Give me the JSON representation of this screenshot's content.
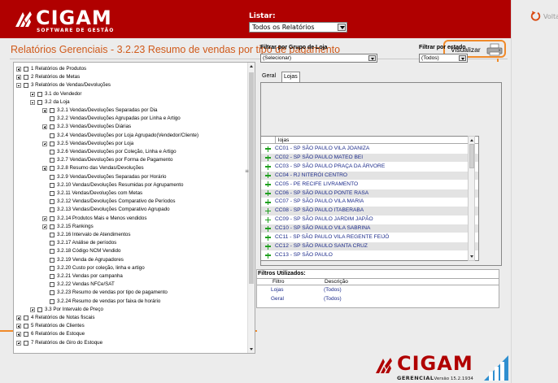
{
  "header": {
    "brand": "CIGAM",
    "brand_sub": "SOFTWARE DE GESTÃO",
    "list_label": "Listar:",
    "list_selected": "Todos os Relatórios"
  },
  "nav": {
    "back_label": "Voltar"
  },
  "page": {
    "title": "Relatórios Gerenciais - 3.2.23 Resumo de vendas por tipo de pagamento",
    "visualize_label": "Visualizar"
  },
  "tree": [
    {
      "label": "1 Relatórios de Produtos",
      "level": 0,
      "expander": "plus"
    },
    {
      "label": "2 Relatórios de Metas",
      "level": 0,
      "expander": "plus"
    },
    {
      "label": "3 Relatórios de Vendas/Devoluções",
      "level": 0,
      "expander": "minus"
    },
    {
      "label": "3.1 do Vendedor",
      "level": 1,
      "expander": "plus"
    },
    {
      "label": "3.2 da Loja",
      "level": 1,
      "expander": "minus"
    },
    {
      "label": "3.2.1 Vendas/Devoluções Separadas por Dia",
      "level": 2,
      "expander": "plus"
    },
    {
      "label": "3.2.2 Vendas/Devoluções Agrupadas por Linha e Artigo",
      "level": 2,
      "expander": "none"
    },
    {
      "label": "3.2.3 Vendas/Devoluções Diárias",
      "level": 2,
      "expander": "plus"
    },
    {
      "label": "3.2.4 Vendas/Devoluções por Loja Agrupado(Vendedor/Cliente)",
      "level": 2,
      "expander": "none"
    },
    {
      "label": "3.2.5 Vendas/Devoluções por Loja",
      "level": 2,
      "expander": "plus"
    },
    {
      "label": "3.2.6 Vendas/Devoluções por Coleção, Linha e Artigo",
      "level": 2,
      "expander": "none"
    },
    {
      "label": "3.2.7 Vendas/Devoluções por Forma de Pagamento",
      "level": 2,
      "expander": "none"
    },
    {
      "label": "3.2.8 Resumo das Vendas/Devoluções",
      "level": 2,
      "expander": "plus"
    },
    {
      "label": "3.2.9 Vendas/Devoluções Separadas por Horário",
      "level": 2,
      "expander": "none"
    },
    {
      "label": "3.2.10 Vendas/Devoluções Resumidas por Agrupamento",
      "level": 2,
      "expander": "none"
    },
    {
      "label": "3.2.11 Vendas/Devoluções com Metas",
      "level": 2,
      "expander": "none"
    },
    {
      "label": "3.2.12 Vendas/Devoluções Comparativo de Períodos",
      "level": 2,
      "expander": "none"
    },
    {
      "label": "3.2.13 Vendas/Devoluções Comparativo Agrupado",
      "level": 2,
      "expander": "none"
    },
    {
      "label": "3.2.14 Produtos Mais e Menos vendidos",
      "level": 2,
      "expander": "plus"
    },
    {
      "label": "3.2.15 Rankings",
      "level": 2,
      "expander": "plus"
    },
    {
      "label": "3.2.16 Intervalo de Atendimentos",
      "level": 2,
      "expander": "none"
    },
    {
      "label": "3.2.17 Análise de períodos",
      "level": 2,
      "expander": "none"
    },
    {
      "label": "3.2.18 Código NCM Vendido",
      "level": 2,
      "expander": "none"
    },
    {
      "label": "3.2.19 Venda de Agrupadores",
      "level": 2,
      "expander": "none"
    },
    {
      "label": "3.2.20 Custo por coleção, linha e artigo",
      "level": 2,
      "expander": "none"
    },
    {
      "label": "3.2.21 Vendas por campanha",
      "level": 2,
      "expander": "none"
    },
    {
      "label": "3.2.22 Vendas NFCe/SAT",
      "level": 2,
      "expander": "none"
    },
    {
      "label": "3.2.23 Resumo de vendas por tipo de pagamento",
      "level": 2,
      "expander": "none"
    },
    {
      "label": "3.2.24 Resumo de vendas por faixa de horário",
      "level": 2,
      "expander": "none"
    },
    {
      "label": "3.3 Por Intervalo de Preço",
      "level": 1,
      "expander": "plus"
    },
    {
      "label": "4 Relatórios de Notas fiscais",
      "level": 0,
      "expander": "plus"
    },
    {
      "label": "5 Relatórios de Clientes",
      "level": 0,
      "expander": "plus"
    },
    {
      "label": "6 Relatórios de Estoque",
      "level": 0,
      "expander": "plus"
    },
    {
      "label": "7 Relatórios de Giro do Estoque",
      "level": 0,
      "expander": "plus"
    }
  ],
  "tabs": [
    "Geral",
    "Lojas"
  ],
  "filters": {
    "group_label": "Filtrar por Grupo de Loja",
    "group_value": "(Selecionar)",
    "state_label": "Filtrar por estado",
    "state_value": "(Todos)"
  },
  "stores": {
    "header": "lojas",
    "rows": [
      "CC01 - SP SÃO PAULO VILA JOANIZA",
      "CC02 - SP SÃO PAULO MATEO BEI",
      "CC03 - SP SÃO PAULO PRAÇA DA ÁRVORE",
      "CC04 - RJ  NITERÓI CENTRO",
      "CC05 - PE RECIFE LIVRAMENTO",
      "CC06 - SP SÃO PAULO PONTE RASA",
      "CC07 - SP SÃO PAULO VILA MARIA",
      "CC08 - SP SÃO PAULO ITABERABA",
      "CC09 - SP SÃO PAULO JARDIM JAPÃO",
      "CC10 - SP SÃO PAULO VILA SABRINA",
      "CC11 - SP SÃO PAULO VILA REGENTE FEIJÓ",
      "CC12 - SP SÃO PAULO SANTA CRUZ",
      "CC13 - SP SÃO PAULO"
    ]
  },
  "used_filters": {
    "title": "Filtros Utilizados:",
    "col_filter": "Filtro",
    "col_desc": "Descrição",
    "rows": [
      {
        "filter": "Lojas",
        "desc": "(Todos)"
      },
      {
        "filter": "Geral",
        "desc": "(Todos)"
      }
    ]
  },
  "footer": {
    "brand": "CIGAM",
    "sub": "GERENCIAL",
    "version": "Versão 15.2.1934"
  },
  "colors": {
    "header_red": "#b00000",
    "title_orange": "#d05a1a",
    "highlight_orange": "#f08a2a",
    "store_text_blue": "#1b2a8a",
    "add_green": "#1fa01f"
  }
}
